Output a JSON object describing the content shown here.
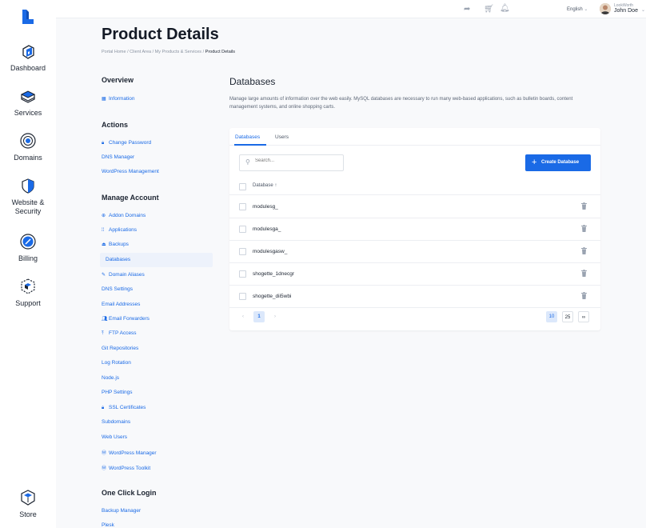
{
  "sidebar": {
    "logo": "brand-logo",
    "items": [
      {
        "label": "Dashboard",
        "icon": "dashboard-icon"
      },
      {
        "label": "Services",
        "icon": "services-icon"
      },
      {
        "label": "Domains",
        "icon": "domains-icon"
      },
      {
        "label": "Website &",
        "label2": "Security",
        "icon": "website-security-icon"
      },
      {
        "label": "Billing",
        "icon": "billing-icon"
      },
      {
        "label": "Support",
        "icon": "support-icon"
      }
    ],
    "store": {
      "label": "Store",
      "icon": "store-icon"
    }
  },
  "topbar": {
    "language": "English",
    "user_sub": "LookWorth",
    "user_name": "John Doe"
  },
  "page": {
    "title": "Product Details",
    "breadcrumb": [
      "Portal Home",
      "Client Area",
      "My Products & Services",
      "Product Details"
    ]
  },
  "left": {
    "overview_title": "Overview",
    "overview_links": [
      "Information"
    ],
    "actions_title": "Actions",
    "actions_links": [
      "Change Password",
      "DNS Manager",
      "WordPress Management"
    ],
    "manage_title": "Manage Account",
    "manage_links": [
      "Addon Domains",
      "Applications",
      "Backups",
      "Databases",
      "Domain Aliases",
      "DNS Settings",
      "Email Addresses",
      "Email Forwarders",
      "FTP Access",
      "Git Repositories",
      "Log Rotation",
      "Node.js",
      "PHP Settings",
      "SSL Certificates",
      "Subdomains",
      "Web Users",
      "WordPress Manager",
      "WordPress Toolkit"
    ],
    "oneclick_title": "One Click Login",
    "oneclick_links": [
      "Backup Manager",
      "Plesk"
    ]
  },
  "main": {
    "title": "Databases",
    "description": "Manage large amounts of information over the web easily. MySQL databases are necessary to run many web-based applications, such as bulletin boards, content management systems, and online shopping carts.",
    "tabs": [
      "Databases",
      "Users"
    ],
    "search_placeholder": "Search...",
    "create_label": "Create Database",
    "column_header": "Database ↑",
    "rows": [
      "modulesg_",
      "modulesga_",
      "modulesgasw_",
      "shogette_1dnecgr",
      "shogette_dii5wbi"
    ],
    "pagination": {
      "prev": "‹",
      "current": "1",
      "next": "›"
    },
    "page_sizes": [
      "10",
      "25",
      "∞"
    ]
  },
  "colors": {
    "accent": "#1a6ae6",
    "active_bg": "#edf2fb"
  }
}
